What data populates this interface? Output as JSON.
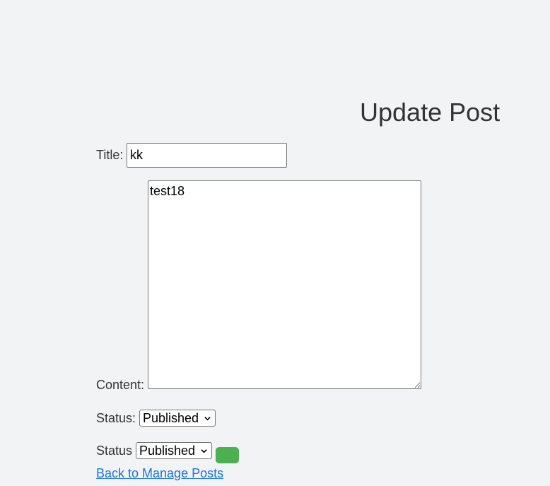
{
  "page": {
    "heading": "Update Post"
  },
  "form": {
    "title_label": "Title:",
    "title_value": "kk",
    "content_label": "Content:",
    "content_value": "test18",
    "status_label_1": "Status:",
    "status_value_1": "Published",
    "status_label_2": "Status",
    "status_value_2": "Published",
    "submit_button_color": "#4caf50"
  },
  "links": {
    "back_label": "Back to Manage Posts"
  },
  "icons": {
    "select_chevron": "chevron-down-icon"
  },
  "colors": {
    "background": "#f2f3f5",
    "link": "#1a73e8",
    "text": "#333333"
  }
}
